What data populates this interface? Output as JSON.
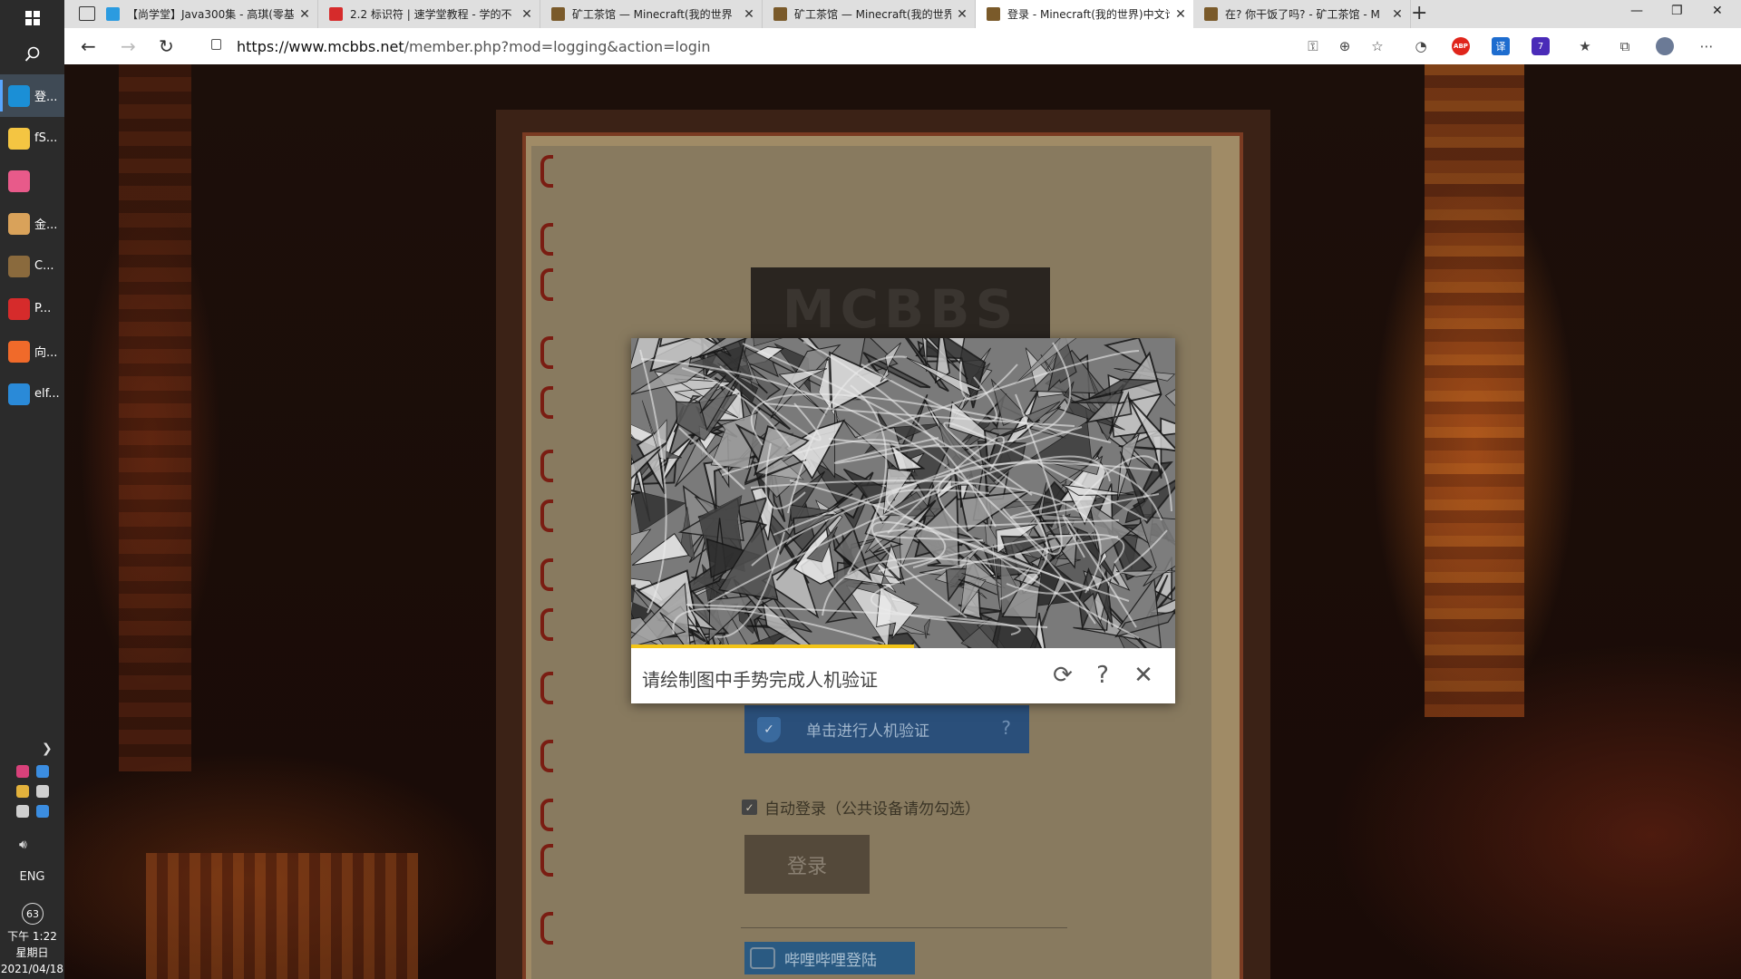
{
  "taskbar": {
    "apps": [
      {
        "label": "登...",
        "icon": "edge-icon",
        "color": "#1b8fd6",
        "active": true
      },
      {
        "label": "fS...",
        "icon": "folder-icon",
        "color": "#f4c542"
      },
      {
        "label": "",
        "icon": "bilibili-icon",
        "color": "#e85a8a"
      },
      {
        "label": "金...",
        "icon": "feather-icon",
        "color": "#d9a25a"
      },
      {
        "label": "C...",
        "icon": "minecraft-chest-icon",
        "color": "#8a6a3d"
      },
      {
        "label": "P...",
        "icon": "netease-music-icon",
        "color": "#d62b2b"
      },
      {
        "label": "向...",
        "icon": "flag-app-icon",
        "color": "#f06a2a"
      },
      {
        "label": "elf...",
        "icon": "vscode-icon",
        "color": "#2a8ad8"
      }
    ],
    "tray": {
      "language": "ENG",
      "badge": "63",
      "time": "下午 1:22",
      "weekday": "星期日",
      "date": "2021/04/18"
    }
  },
  "browser": {
    "tabs": [
      {
        "title": "【尚学堂】Java300集 - 高琪(零基",
        "favicon_color": "#2b9be0"
      },
      {
        "title": "2.2 标识符 | 速学堂教程 - 学的不",
        "favicon_color": "#d62b2b"
      },
      {
        "title": "矿工茶馆 — Minecraft(我的世界",
        "favicon_color": "#7a5a2a"
      },
      {
        "title": "矿工茶馆 — Minecraft(我的世界",
        "favicon_color": "#7a5a2a"
      },
      {
        "title": "登录 - Minecraft(我的世界)中文论",
        "favicon_color": "#7a5a2a",
        "active": true
      },
      {
        "title": "在? 你干饭了吗? - 矿工茶馆 - M",
        "favicon_color": "#7a5a2a"
      }
    ],
    "url_host": "https://www.mcbbs.net",
    "url_path": "/member.php?mod=logging&action=login"
  },
  "page": {
    "logo_text": "MCBBS",
    "verify_button_label": "单击进行人机验证",
    "remember_label": "自动登录（公共设备请勿勾选）",
    "remember_checked": true,
    "login_button_label": "登录",
    "bilibili_login_label": "哔哩哔哩登陆"
  },
  "captcha": {
    "prompt": "请绘制图中手势完成人机验证",
    "progress": 0.52,
    "progress_color": "#f2c418"
  }
}
